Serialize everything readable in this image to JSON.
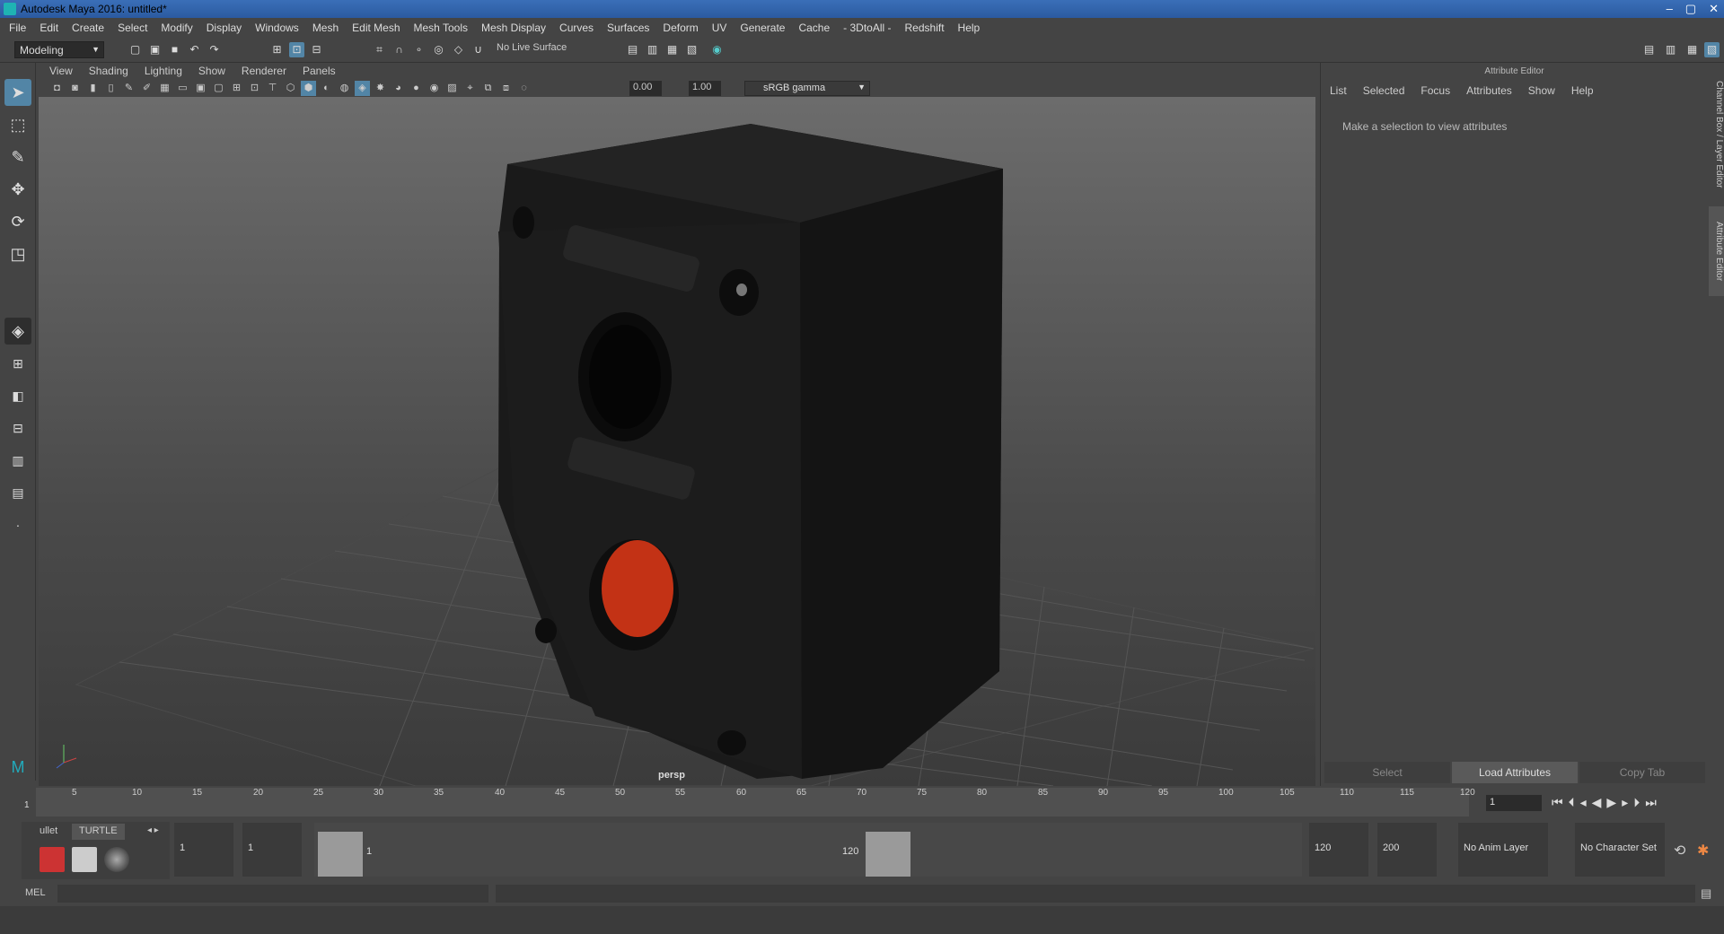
{
  "window": {
    "title": "Autodesk Maya 2016: untitled*",
    "min": "–",
    "max": "▢",
    "close": "✕"
  },
  "menus": [
    "File",
    "Edit",
    "Create",
    "Select",
    "Modify",
    "Display",
    "Windows",
    "Mesh",
    "Edit Mesh",
    "Mesh Tools",
    "Mesh Display",
    "Curves",
    "Surfaces",
    "Deform",
    "UV",
    "Generate",
    "Cache",
    "- 3DtoAll -",
    "Redshift",
    "Help"
  ],
  "shelf": {
    "mode": "Modeling",
    "live_surface": "No Live Surface"
  },
  "viewport": {
    "menus": [
      "View",
      "Shading",
      "Lighting",
      "Show",
      "Renderer",
      "Panels"
    ],
    "exposure": "0.00",
    "gamma_value": "1.00",
    "color_space": "sRGB gamma",
    "camera": "persp"
  },
  "attribute_editor": {
    "title": "Attribute Editor",
    "menus": [
      "List",
      "Selected",
      "Focus",
      "Attributes",
      "Show",
      "Help"
    ],
    "message": "Make a selection to view attributes",
    "buttons": {
      "select": "Select",
      "load": "Load Attributes",
      "copy": "Copy Tab"
    }
  },
  "side_tabs": {
    "channel": "Channel Box / Layer Editor",
    "attr": "Attribute Editor"
  },
  "timeline": {
    "ticks": [
      "5",
      "10",
      "15",
      "20",
      "25",
      "30",
      "35",
      "40",
      "45",
      "50",
      "55",
      "60",
      "65",
      "70",
      "75",
      "80",
      "85",
      "90",
      "95",
      "100",
      "105",
      "110",
      "115",
      "120"
    ],
    "start_label": "1",
    "current_frame": "1"
  },
  "range": {
    "shelf_tabs": {
      "bullet": "ullet",
      "turtle": "TURTLE"
    },
    "start": "1",
    "anim_start": "1",
    "range_start": "1",
    "range_end": "120",
    "anim_end": "120",
    "end": "200",
    "anim_layer": "No Anim Layer",
    "char_set": "No Character Set"
  },
  "command": {
    "label": "MEL"
  }
}
